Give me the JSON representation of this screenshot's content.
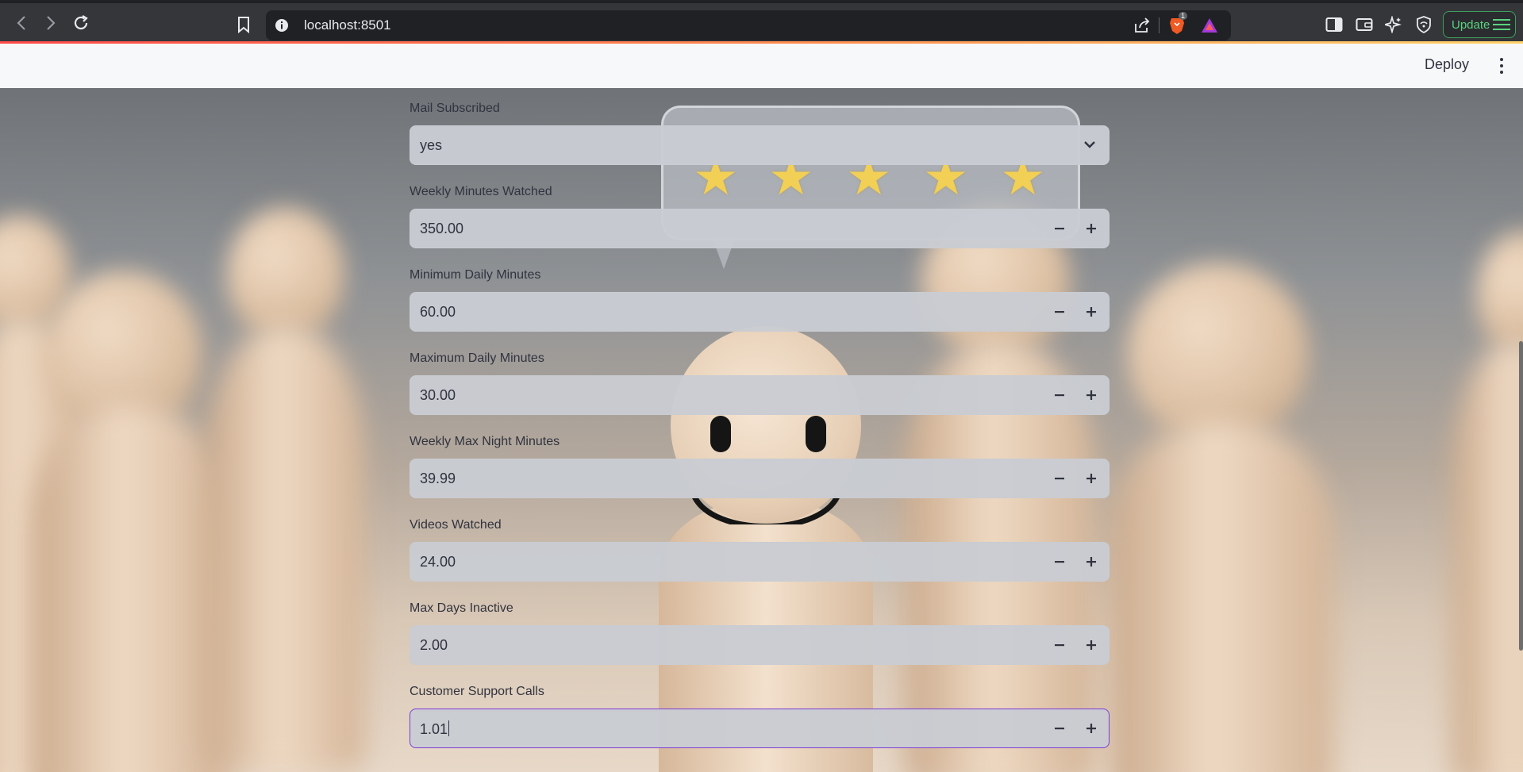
{
  "browser": {
    "url": "localhost:8501",
    "update_label": "Update",
    "brave_badge": "1"
  },
  "header": {
    "deploy_label": "Deploy"
  },
  "form": {
    "mail_subscribed": {
      "label": "Mail Subscribed",
      "value": "yes"
    },
    "fields": [
      {
        "label": "Weekly Minutes Watched",
        "value": "350.00"
      },
      {
        "label": "Minimum Daily Minutes",
        "value": "60.00"
      },
      {
        "label": "Maximum Daily Minutes",
        "value": "30.00"
      },
      {
        "label": "Weekly Max Night Minutes",
        "value": "39.99"
      },
      {
        "label": "Videos Watched",
        "value": "24.00"
      },
      {
        "label": "Max Days Inactive",
        "value": "2.00"
      },
      {
        "label": "Customer Support Calls",
        "value": "1.01"
      }
    ],
    "minus_symbol": "−",
    "plus_symbol": "+"
  },
  "colors": {
    "focus_border": "#7d3cd6",
    "input_bg": "#c9ccd2",
    "text": "#31333f"
  }
}
